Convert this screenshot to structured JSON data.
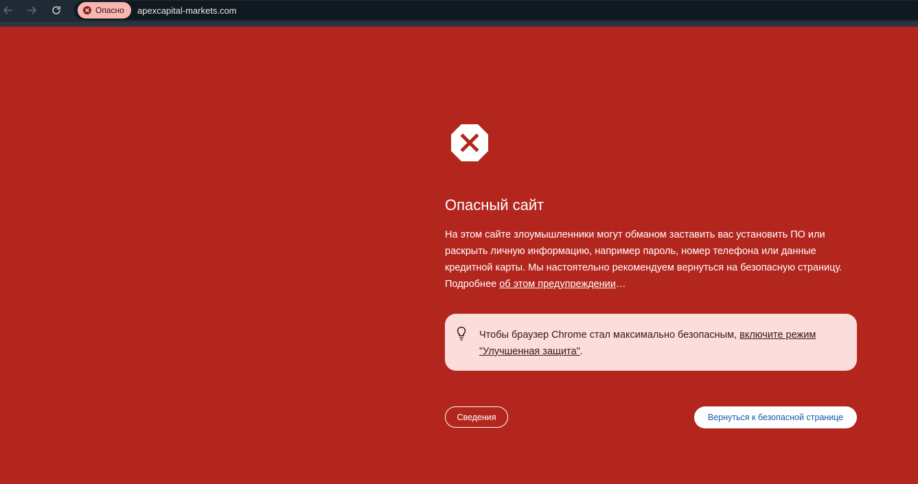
{
  "browser": {
    "security_chip_label": "Опасно",
    "url": "apexcapital-markets.com",
    "icons": {
      "back": "arrow-left-icon",
      "forward": "arrow-right-icon",
      "reload": "reload-icon",
      "chip": "danger-x-icon"
    }
  },
  "warning": {
    "icon": "stop-sign-x-icon",
    "title": "Опасный сайт",
    "body_text": "На этом сайте злоумышленники могут обманом заставить вас установить ПО или раскрыть личную информацию, например пароль, номер телефона или данные кредитной карты. Мы настоятельно рекомендуем вернуться на безопасную страницу. Подробнее ",
    "learn_more_link": "об этом предупреждении",
    "learn_more_suffix": "…"
  },
  "tip": {
    "icon": "lightbulb-icon",
    "text_prefix": "Чтобы браузер Chrome стал максимально безопасным, ",
    "link": "включите режим \"Улучшенная защита\"",
    "text_suffix": "."
  },
  "actions": {
    "details_label": "Сведения",
    "back_to_safety_label": "Вернуться к безопасной странице"
  },
  "colors": {
    "background": "#b3261e",
    "tip_background": "#fbdedc",
    "primary_button_text": "#1558b0"
  }
}
